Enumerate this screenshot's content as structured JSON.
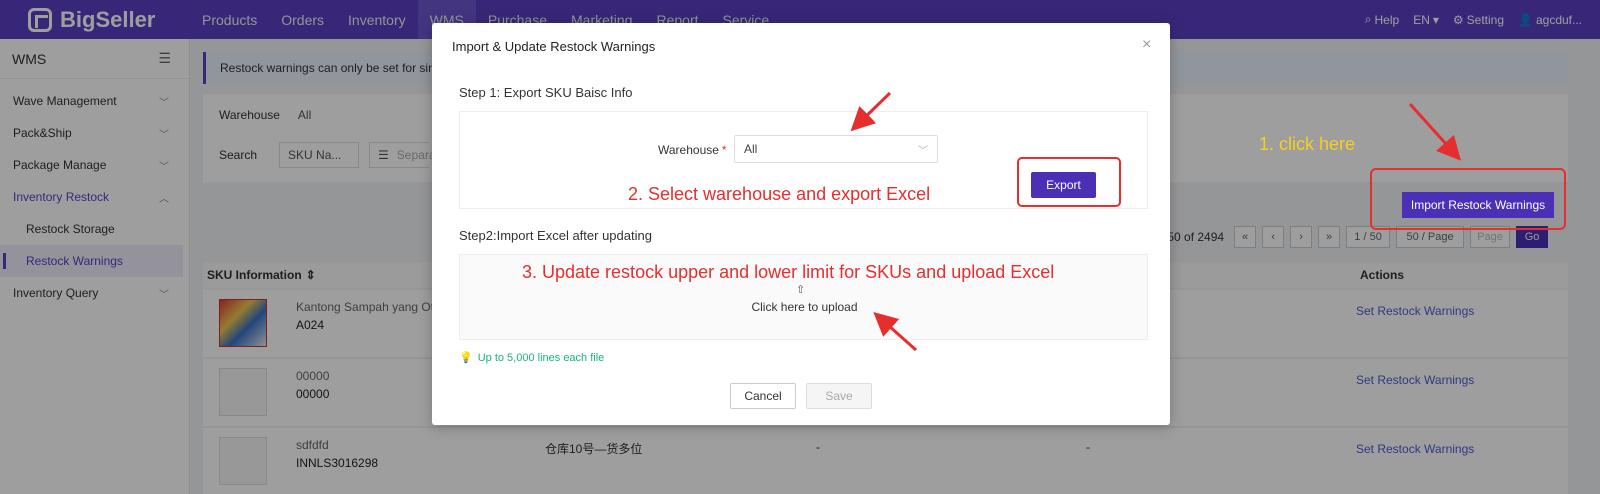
{
  "app": {
    "logo": "BigSeller"
  },
  "nav": {
    "items": [
      {
        "label": "Products"
      },
      {
        "label": "Orders"
      },
      {
        "label": "Inventory"
      },
      {
        "label": "WMS",
        "active": true
      },
      {
        "label": "Purchase"
      },
      {
        "label": "Marketing"
      },
      {
        "label": "Report"
      },
      {
        "label": "Service"
      }
    ],
    "help": "Help",
    "lang": "EN",
    "setting": "Setting",
    "user": "agcduf..."
  },
  "sidebar": {
    "title": "WMS",
    "items": [
      {
        "label": "Wave Management"
      },
      {
        "label": "Pack&Ship"
      },
      {
        "label": "Package Manage"
      },
      {
        "label": "Inventory Restock"
      },
      {
        "label": "Restock Storage"
      },
      {
        "label": "Restock Warnings"
      },
      {
        "label": "Inventory Query"
      }
    ]
  },
  "main": {
    "alert": "Restock warnings can only be set for sing",
    "filters": {
      "warehouse_label": "Warehouse",
      "warehouse_value": "All",
      "search_label": "Search",
      "search_field": "SKU Na...",
      "search_placeholder": "Separa"
    },
    "import_button": "Import Restock Warnings",
    "pager": {
      "summary": "1 - 50 of 2494",
      "current": "1 / 50",
      "size": "50 / Page",
      "page_placeholder": "Page",
      "go": "Go"
    },
    "table": {
      "col_sku": "SKU Information",
      "col_actions": "Actions",
      "rows": [
        {
          "name": "Kantong Sampah yang Ot",
          "sku": "A024",
          "action": "Set Restock Warnings"
        },
        {
          "name": "00000",
          "sku": "00000",
          "action": "Set Restock Warnings"
        },
        {
          "name": "sdfdfd",
          "sku": "INNLS3016298",
          "location": "仓库10号—货多位",
          "c1": "-",
          "c2": "-",
          "action": "Set Restock Warnings"
        }
      ]
    }
  },
  "modal": {
    "title": "Import & Update Restock Warnings",
    "close": "×",
    "step1": "Step 1: Export SKU Baisc Info",
    "warehouse_label": "Warehouse",
    "required_mark": "*",
    "warehouse_value": "All",
    "export_button": "Export",
    "step2": "Step2:Import Excel after updating",
    "upload_text": "Click here to upload",
    "tip": "Up to 5,000 lines each file",
    "cancel": "Cancel",
    "save": "Save"
  },
  "annotations": {
    "a1": "1. click here",
    "a2": "2. Select warehouse and export Excel",
    "a3": "3. Update restock upper and lower limit for SKUs and upload Excel"
  },
  "colors": {
    "brand": "#5b3fc4",
    "annotation_red": "#e52e2e",
    "annotation_yellow": "#f5d020",
    "tip_green": "#19b37a"
  }
}
